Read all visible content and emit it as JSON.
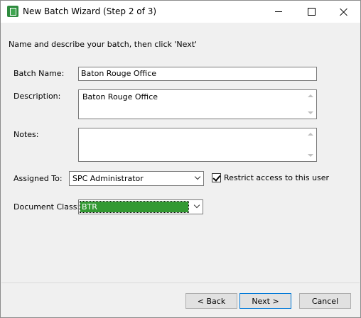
{
  "window": {
    "title": "New Batch Wizard (Step 2 of 3)",
    "icon": "batch-wizard-app-icon"
  },
  "instruction": "Name and describe your batch, then click 'Next'",
  "fields": {
    "batch_name": {
      "label": "Batch Name:",
      "value": "Baton Rouge Office"
    },
    "description": {
      "label": "Description:",
      "value": "Baton Rouge Office"
    },
    "notes": {
      "label": "Notes:",
      "value": ""
    },
    "assigned_to": {
      "label": "Assigned To:",
      "value": "SPC  Administrator"
    },
    "document_class": {
      "label": "Document Class:",
      "value": "BTR",
      "highlight_color": "#339933"
    }
  },
  "restrict_access": {
    "label": "Restrict access to this user",
    "checked": true
  },
  "buttons": {
    "back": "< Back",
    "next": "Next >",
    "cancel": "Cancel"
  }
}
